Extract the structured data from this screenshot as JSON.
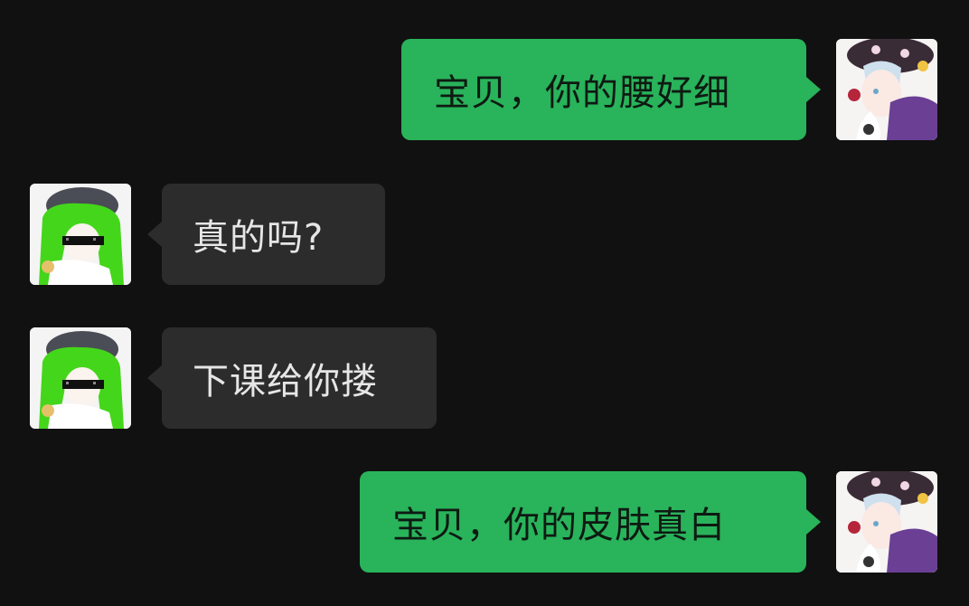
{
  "messages": [
    {
      "direction": "outgoing",
      "text": "宝贝，你的腰好细",
      "avatar": "boy-avatar"
    },
    {
      "direction": "incoming",
      "text": "真的吗?",
      "avatar": "green-hair-sunglasses-avatar"
    },
    {
      "direction": "incoming",
      "text": "下课给你搂",
      "avatar": "green-hair-sunglasses-avatar"
    },
    {
      "direction": "outgoing",
      "text": "宝贝，你的皮肤真白",
      "avatar": "boy-avatar"
    }
  ],
  "colors": {
    "background": "#111111",
    "outgoing_bubble": "#29b35b",
    "incoming_bubble": "#2c2c2c",
    "incoming_text": "#e6e6e6",
    "outgoing_text": "#0e1a12"
  }
}
